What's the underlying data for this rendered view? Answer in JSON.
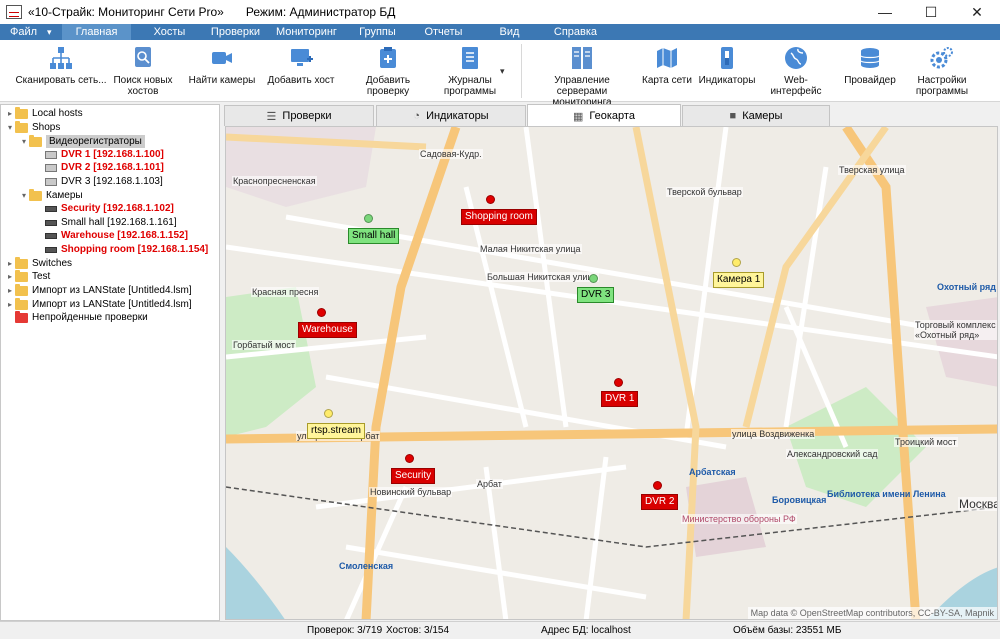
{
  "window": {
    "title": "«10-Страйк: Мониторинг Сети Pro»",
    "mode": "Режим: Администратор БД",
    "min": "—",
    "max": "☐",
    "close": "✕"
  },
  "menu": {
    "file": "Файл",
    "arrow": "▾",
    "tabs": [
      "Главная",
      "Хосты",
      "Проверки",
      "Мониторинг",
      "Группы",
      "Отчеты",
      "Вид",
      "Справка"
    ]
  },
  "ribbon": {
    "buttons": [
      {
        "label": "Сканировать сеть...",
        "icon": "network-scan-icon"
      },
      {
        "label": "Поиск новых хостов",
        "icon": "search-hosts-icon"
      },
      {
        "label": "Найти камеры",
        "icon": "camera-search-icon"
      },
      {
        "label": "Добавить хост",
        "icon": "add-host-icon"
      },
      {
        "label": "Добавить проверку",
        "icon": "add-check-icon"
      },
      {
        "label": "Журналы программы",
        "icon": "logs-icon"
      },
      {
        "label": "Управление серверами мониторинга",
        "icon": "servers-icon"
      },
      {
        "label": "Карта сети",
        "icon": "network-map-icon"
      },
      {
        "label": "Индикаторы",
        "icon": "indicators-icon"
      },
      {
        "label": "Web-интерфейс",
        "icon": "web-interface-icon"
      },
      {
        "label": "Провайдер",
        "icon": "provider-icon"
      },
      {
        "label": "Настройки программы",
        "icon": "settings-icon"
      }
    ],
    "chevron": "▾"
  },
  "tree": {
    "items": [
      {
        "label": "Local hosts",
        "level": 0,
        "icon": "folder-icon"
      },
      {
        "label": "Shops",
        "level": 0,
        "icon": "folder-icon"
      },
      {
        "label": "Видеорегистраторы",
        "level": 1,
        "icon": "folder-icon"
      },
      {
        "label": "DVR 1 [192.168.1.100]",
        "level": 2,
        "icon": "dvr-icon",
        "alert": true
      },
      {
        "label": "DVR 2 [192.168.1.101]",
        "level": 2,
        "icon": "dvr-icon",
        "alert": true
      },
      {
        "label": "DVR 3 [192.168.1.103]",
        "level": 2,
        "icon": "dvr-icon",
        "alert": false
      },
      {
        "label": "Камеры",
        "level": 1,
        "icon": "folder-icon"
      },
      {
        "label": "Security [192.168.1.102]",
        "level": 2,
        "icon": "camera-icon",
        "alert": true
      },
      {
        "label": "Small hall [192.168.1.161]",
        "level": 2,
        "icon": "camera-icon",
        "alert": false
      },
      {
        "label": "Warehouse [192.168.1.152]",
        "level": 2,
        "icon": "camera-icon",
        "alert": true
      },
      {
        "label": "Shopping room [192.168.1.154]",
        "level": 2,
        "icon": "camera-icon",
        "alert": true
      },
      {
        "label": "Switches",
        "level": 0,
        "icon": "folder-icon"
      },
      {
        "label": "Test",
        "level": 0,
        "icon": "folder-icon"
      },
      {
        "label": "Импорт из LANState [Untitled4.lsm]",
        "level": 0,
        "icon": "folder-icon"
      },
      {
        "label": "Импорт из LANState [Untitled4.lsm]",
        "level": 0,
        "icon": "folder-icon"
      },
      {
        "label": "Непройденные проверки",
        "level": 0,
        "icon": "failed-folder-icon"
      }
    ]
  },
  "tabs": [
    {
      "label": "Проверки",
      "icon": "checks-icon"
    },
    {
      "label": "Индикаторы",
      "icon": "gauge-icon"
    },
    {
      "label": "Геокарта",
      "icon": "geomap-icon"
    },
    {
      "label": "Камеры",
      "icon": "camera-icon"
    }
  ],
  "map": {
    "markers": [
      {
        "label": "Shopping room",
        "status": "red"
      },
      {
        "label": "Small hall",
        "status": "green"
      },
      {
        "label": "DVR 3",
        "status": "green"
      },
      {
        "label": "Камера 1",
        "status": "yellow"
      },
      {
        "label": "Warehouse",
        "status": "red"
      },
      {
        "label": "DVR 1",
        "status": "red"
      },
      {
        "label": "rtsp.stream",
        "status": "yellow"
      },
      {
        "label": "Security",
        "status": "red"
      },
      {
        "label": "DVR 2",
        "status": "red"
      }
    ],
    "streets": [
      "Краснопресненская",
      "улица Новый Арбат",
      "улица Воздвиженка",
      "Малая Никитская улица",
      "Большая Никитская улица",
      "Тверская улица",
      "Арбат",
      "Новинский бульвар",
      "Садовая-Кудр.",
      "Смоленская",
      "Арбатская",
      "Боровицкая",
      "Александровский сад",
      "Библиотека имени Ленина",
      "Москва",
      "Охотный ряд",
      "Министерство обороны РФ",
      "Торговый комплекс «Охотный ряд»",
      "Горбатый мост",
      "Троицкий мост",
      "Красная пресня",
      "Тверской бульвар"
    ],
    "attribution": "Map data © OpenStreetMap contributors, CC-BY-SA, Mapnik"
  },
  "status": {
    "checks": "Проверок: 3/719",
    "hosts": "Хостов: 3/154",
    "db": "Адрес БД: localhost",
    "size": "Объём базы: 23551 МБ"
  }
}
